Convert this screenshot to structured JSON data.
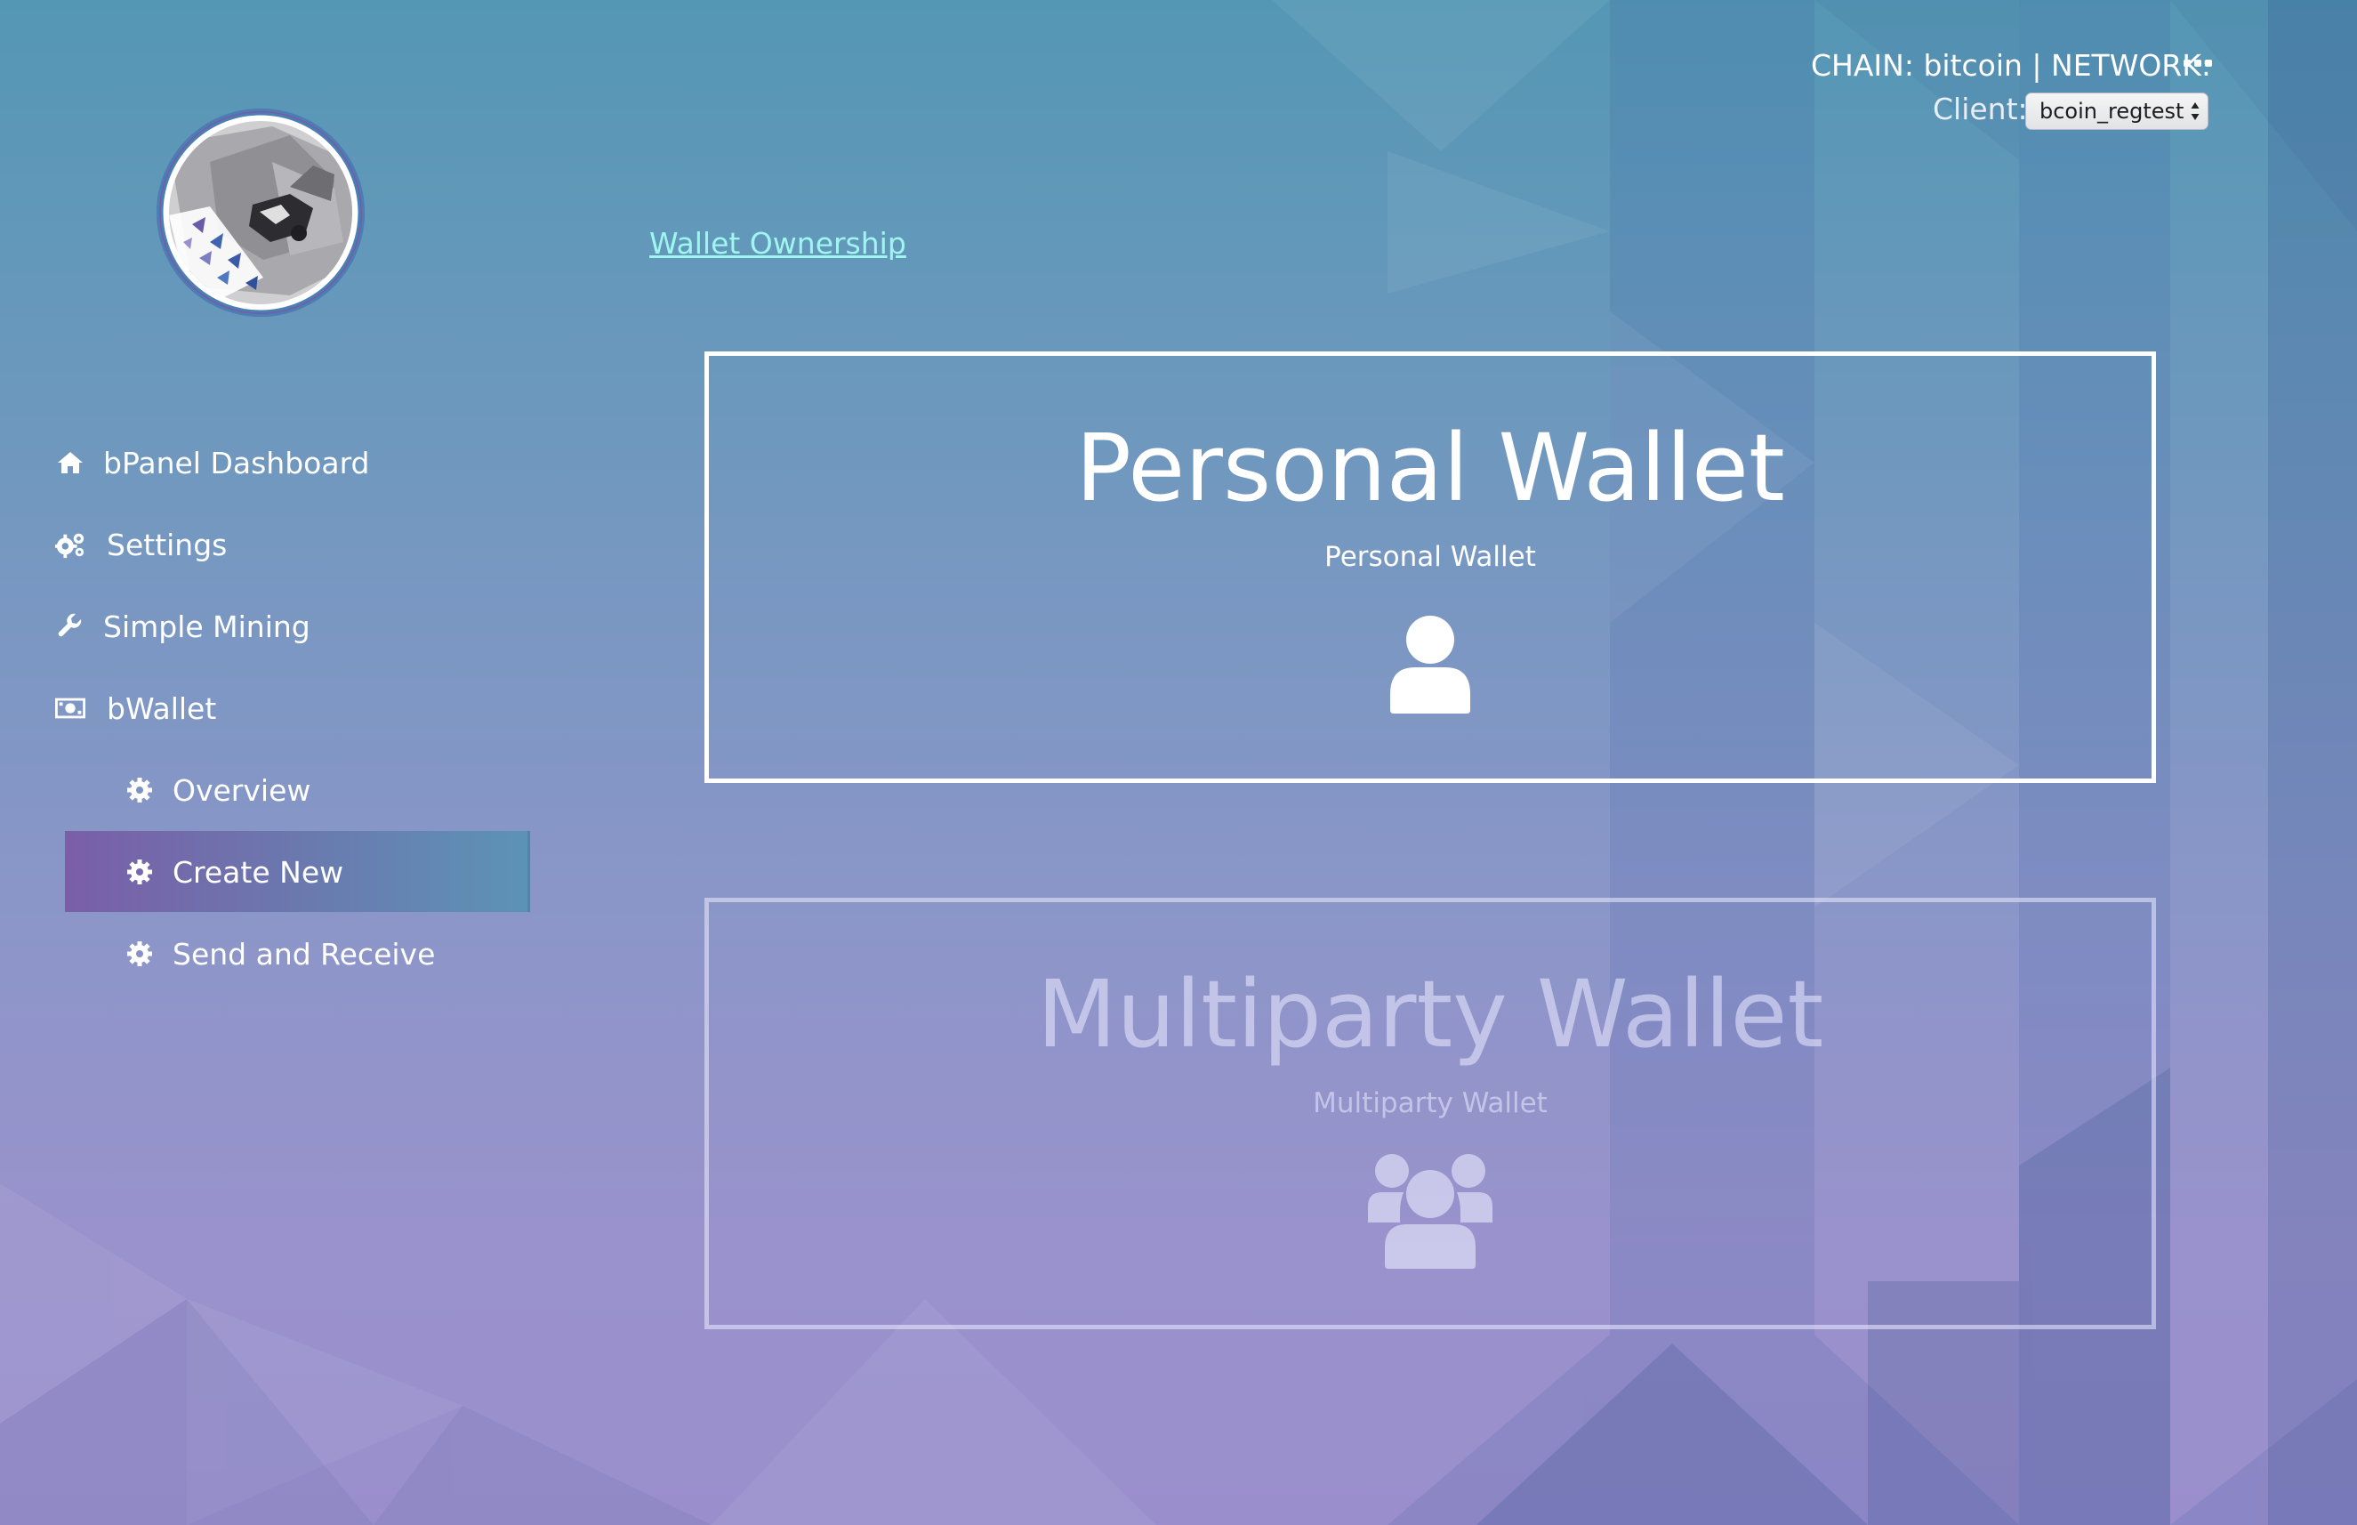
{
  "header": {
    "chain_network": "CHAIN: bitcoin | NETWORK:",
    "more_icon": "ellipsis-icon",
    "client_label": "Client:",
    "client_selected": "bcoin_regtest"
  },
  "breadcrumb": {
    "link_text": "Wallet Ownership"
  },
  "sidebar": {
    "items": [
      {
        "label": "bPanel Dashboard",
        "icon": "home-icon"
      },
      {
        "label": "Settings",
        "icon": "gears-icon"
      },
      {
        "label": "Simple Mining",
        "icon": "wrench-icon"
      },
      {
        "label": "bWallet",
        "icon": "money-bill-icon"
      }
    ],
    "subitems": [
      {
        "label": "Overview",
        "icon": "cog-icon"
      },
      {
        "label": "Create New",
        "icon": "cog-icon",
        "active": true
      },
      {
        "label": "Send and Receive",
        "icon": "cog-icon"
      }
    ]
  },
  "cards": {
    "personal": {
      "title": "Personal Wallet",
      "subtitle": "Personal Wallet",
      "icon": "user-icon"
    },
    "multiparty": {
      "title": "Multiparty Wallet",
      "subtitle": "Multiparty Wallet",
      "icon": "users-icon"
    }
  },
  "colors": {
    "link": "#9ef6ef",
    "active_nav_start": "#7a5ea8",
    "active_nav_end": "#5c93b6"
  }
}
